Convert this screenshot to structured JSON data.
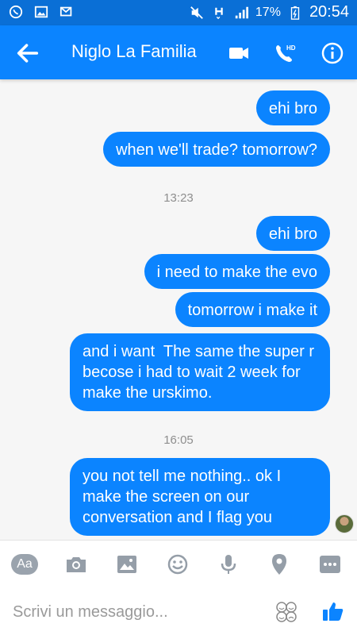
{
  "status_bar": {
    "battery": "17%",
    "time": "20:54"
  },
  "header": {
    "title": "Niglo La Familia"
  },
  "messages": [
    {
      "text": "ehi bro"
    },
    {
      "text": "when we'll trade? tomorrow?"
    },
    {
      "text": "ehi bro"
    },
    {
      "text": "i need to make the evo"
    },
    {
      "text": "tomorrow i make it"
    },
    {
      "text": "and i want  The same the super r becose i had to wait 2 week for make the urskimo."
    },
    {
      "text": "you not tell me nothing.. ok I make the screen on our conversation and I flag you"
    }
  ],
  "timestamps": [
    "13:23",
    "16:05"
  ],
  "toolbar": {
    "aa_label": "Aa"
  },
  "composer": {
    "placeholder": "Scrivi un messaggio..."
  },
  "colors": {
    "accent": "#0b84ff",
    "status_bar": "#0a6fd6",
    "bubble_text": "#ffffff"
  },
  "icons": [
    "back-arrow-icon",
    "video-call-icon",
    "hd-phone-icon",
    "info-icon",
    "camera-icon",
    "gallery-icon",
    "emoji-icon",
    "microphone-icon",
    "location-pin-icon",
    "more-icon",
    "stickers-icon",
    "thumbs-up-icon"
  ]
}
